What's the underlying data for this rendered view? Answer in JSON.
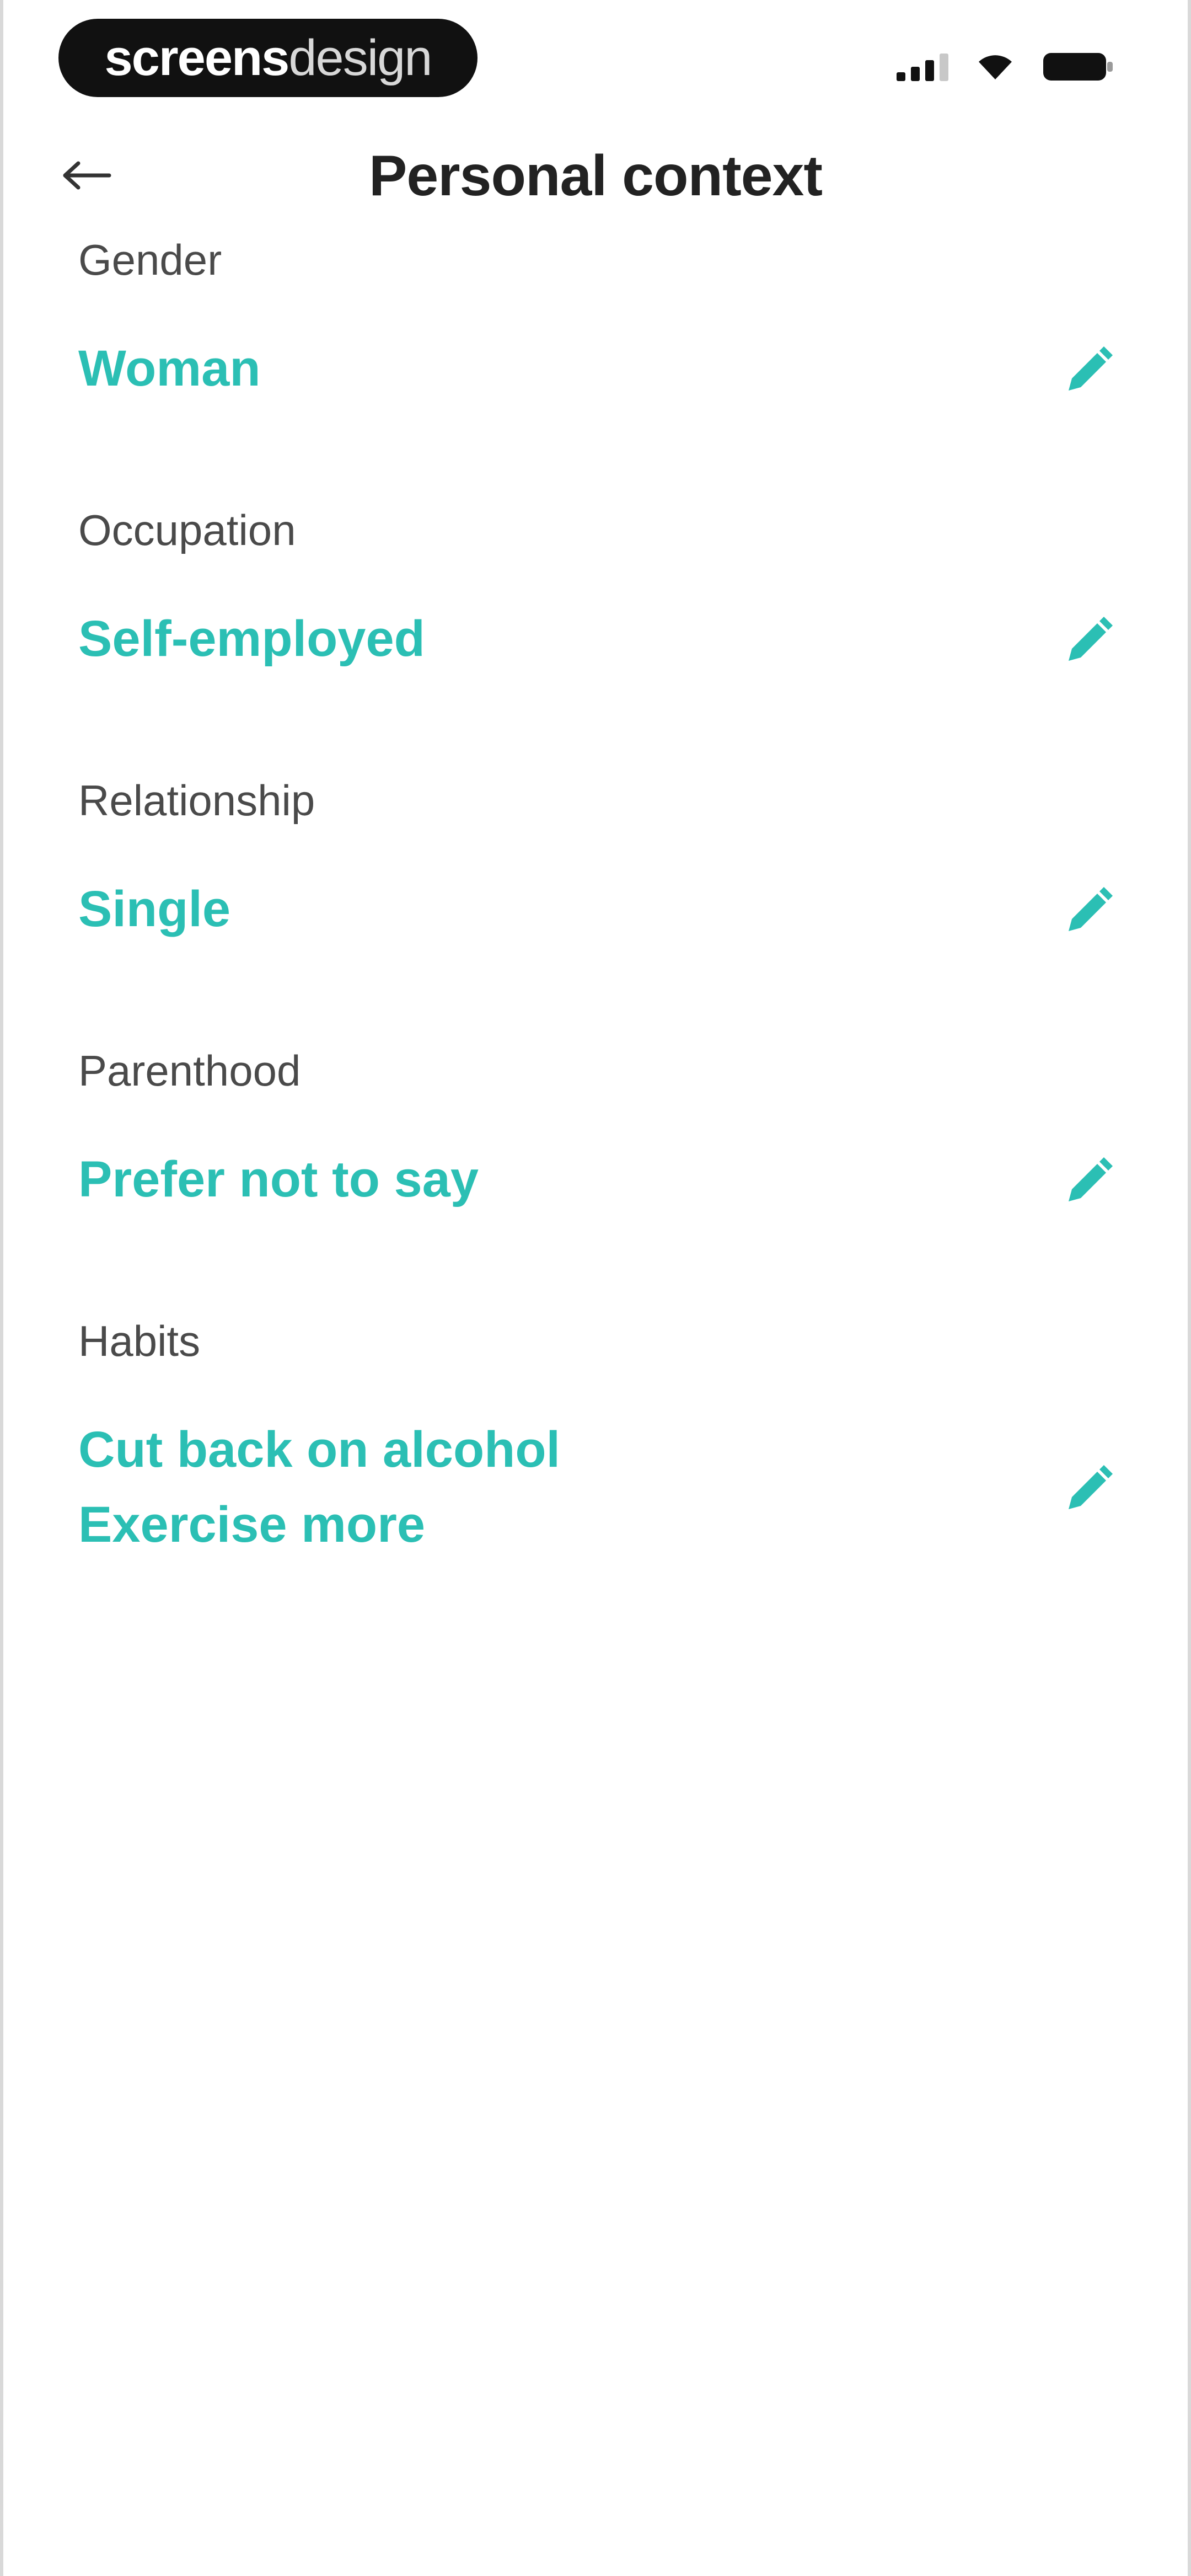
{
  "status_bar": {
    "brand_bold": "screens",
    "brand_light": "design"
  },
  "header": {
    "title": "Personal context",
    "back_icon": "arrow-left-icon"
  },
  "fields": {
    "gender": {
      "label": "Gender",
      "value": "Woman"
    },
    "occupation": {
      "label": "Occupation",
      "value": "Self-employed"
    },
    "relationship": {
      "label": "Relationship",
      "value": "Single"
    },
    "parenthood": {
      "label": "Parenthood",
      "value": "Prefer not to say"
    },
    "habits": {
      "label": "Habits",
      "values": [
        "Cut back on alcohol",
        "Exercise more"
      ]
    }
  },
  "icons": {
    "edit": "pencil-icon"
  },
  "colors": {
    "accent": "#2bbfb4",
    "title": "#222222",
    "label": "#4a4a4a",
    "background": "#ffffff"
  }
}
